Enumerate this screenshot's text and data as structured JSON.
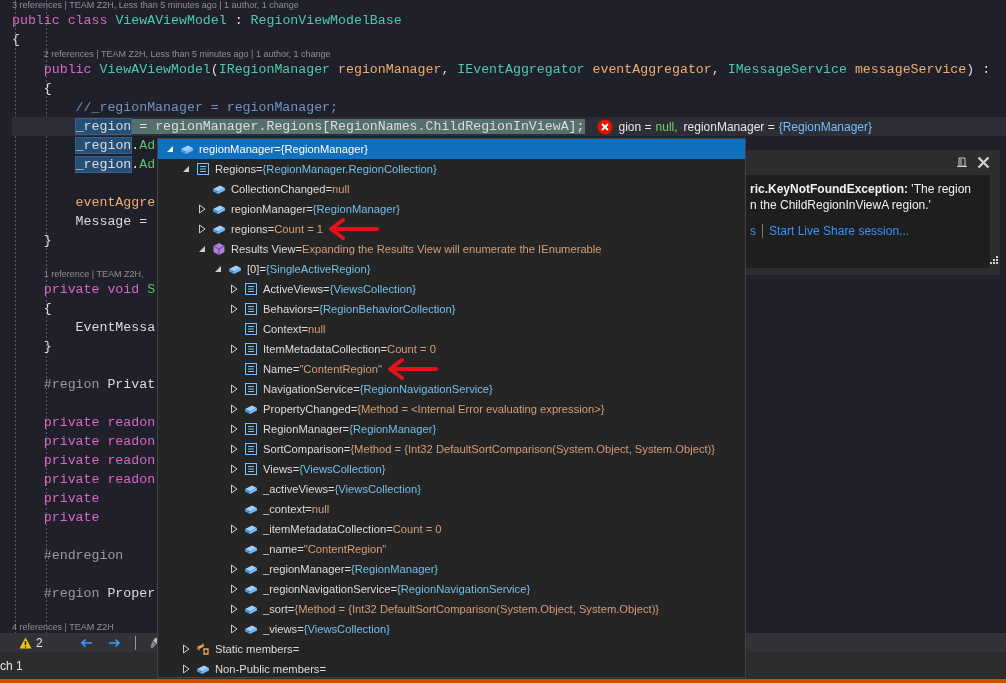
{
  "editor": {
    "lines": [
      {
        "kind": "lens",
        "text": "3 references | TEAM Z2H, Less than 5 minutes ago | 1 author, 1 change"
      },
      {
        "kind": "code",
        "tokens": [
          {
            "text": "public",
            "kind": "keyword"
          },
          {
            "text": " class",
            "kind": "keyword"
          },
          {
            "text": " ViewAViewModel",
            "kind": "type"
          },
          {
            "text": " :",
            "kind": "plain"
          },
          {
            "text": " RegionViewModelBase",
            "kind": "type"
          }
        ]
      },
      {
        "kind": "code",
        "tokens": [
          {
            "text": "{",
            "kind": "plain"
          }
        ]
      },
      {
        "kind": "lens",
        "text": "2 references | TEAM Z2H, Less than 5 minutes ago | 1 author, 1 change"
      },
      {
        "kind": "code",
        "tokens": [
          {
            "text": "    public",
            "kind": "keyword"
          },
          {
            "text": " ViewAViewModel",
            "kind": "type"
          },
          {
            "text": "(",
            "kind": "plain"
          },
          {
            "text": "IRegionManager",
            "kind": "type"
          },
          {
            "text": " regionManager",
            "kind": "param"
          },
          {
            "text": ",",
            "kind": "plain"
          },
          {
            "text": " IEventAggregator",
            "kind": "type"
          },
          {
            "text": " eventAggregator",
            "kind": "param"
          },
          {
            "text": ",",
            "kind": "plain"
          },
          {
            "text": " IMessageService",
            "kind": "type"
          },
          {
            "text": " messageService",
            "kind": "param"
          },
          {
            "text": ") :",
            "kind": "plain"
          }
        ]
      },
      {
        "kind": "code",
        "tokens": [
          {
            "text": "    {",
            "kind": "plain"
          }
        ]
      },
      {
        "kind": "code",
        "tokens": [
          {
            "text": "        //_regionManager = regionManager;",
            "kind": "comment"
          }
        ]
      },
      {
        "kind": "current",
        "tokens": [
          {
            "text": "        _region",
            "kind": "selected"
          },
          {
            "text": " = regionManager.Regions[RegionNames.ChildRegionInViewA];",
            "kind": "plain"
          }
        ],
        "datatip": [
          {
            "name": "gion =",
            "value": {
              "text": "null,",
              "kind": "literal"
            }
          },
          {
            "name": "regionManager =",
            "value": {
              "text": "{RegionManager}",
              "kind": "object"
            }
          }
        ]
      },
      {
        "kind": "code",
        "tokens": [
          {
            "text": "        _region",
            "kind": "selected"
          },
          {
            "text": ".",
            "kind": "plain"
          },
          {
            "text": "Ad",
            "kind": "method"
          }
        ]
      },
      {
        "kind": "code",
        "tokens": [
          {
            "text": "        _region",
            "kind": "selected"
          },
          {
            "text": ".",
            "kind": "plain"
          },
          {
            "text": "Ad",
            "kind": "method"
          }
        ]
      },
      {
        "kind": "blank"
      },
      {
        "kind": "code",
        "tokens": [
          {
            "text": "        eventAggre",
            "kind": "param"
          }
        ]
      },
      {
        "kind": "code",
        "tokens": [
          {
            "text": "        Message =",
            "kind": "plain"
          }
        ]
      },
      {
        "kind": "code",
        "tokens": [
          {
            "text": "    }",
            "kind": "plain"
          }
        ]
      },
      {
        "kind": "blank"
      },
      {
        "kind": "lens",
        "text": "1 reference | TEAM Z2H,"
      },
      {
        "kind": "code",
        "tokens": [
          {
            "text": "    private",
            "kind": "keyword"
          },
          {
            "text": " void",
            "kind": "keyword"
          },
          {
            "text": " S",
            "kind": "method"
          }
        ]
      },
      {
        "kind": "code",
        "tokens": [
          {
            "text": "    {",
            "kind": "plain"
          }
        ]
      },
      {
        "kind": "code",
        "tokens": [
          {
            "text": "        EventMessa",
            "kind": "plain"
          }
        ]
      },
      {
        "kind": "code",
        "tokens": [
          {
            "text": "    }",
            "kind": "plain"
          }
        ]
      },
      {
        "kind": "blank"
      },
      {
        "kind": "code",
        "tokens": [
          {
            "text": "    #region",
            "kind": "directive"
          },
          {
            "text": " Privat",
            "kind": "plain"
          }
        ]
      },
      {
        "kind": "blank"
      },
      {
        "kind": "code",
        "tokens": [
          {
            "text": "    private",
            "kind": "keyword"
          },
          {
            "text": " readon",
            "kind": "keyword"
          }
        ]
      },
      {
        "kind": "code",
        "tokens": [
          {
            "text": "    private",
            "kind": "keyword"
          },
          {
            "text": " readon",
            "kind": "keyword"
          }
        ]
      },
      {
        "kind": "code",
        "tokens": [
          {
            "text": "    private",
            "kind": "keyword"
          },
          {
            "text": " readon",
            "kind": "keyword"
          }
        ]
      },
      {
        "kind": "code",
        "tokens": [
          {
            "text": "    private",
            "kind": "keyword"
          },
          {
            "text": " readon",
            "kind": "keyword"
          }
        ]
      },
      {
        "kind": "code",
        "tokens": [
          {
            "text": "    private",
            "kind": "keyword"
          }
        ]
      },
      {
        "kind": "code",
        "tokens": [
          {
            "text": "    private",
            "kind": "keyword"
          }
        ]
      },
      {
        "kind": "blank"
      },
      {
        "kind": "code",
        "tokens": [
          {
            "text": "    #endregion",
            "kind": "directive"
          }
        ]
      },
      {
        "kind": "blank"
      },
      {
        "kind": "code",
        "tokens": [
          {
            "text": "    #region",
            "kind": "directive"
          },
          {
            "text": " Proper",
            "kind": "plain"
          }
        ]
      },
      {
        "kind": "blank"
      },
      {
        "kind": "lens",
        "text": "4 references | TEAM Z2H"
      }
    ]
  },
  "popup": {
    "items": [
      {
        "name": "regionManager=",
        "value": {
          "text": "{RegionManager}",
          "kind": "object"
        },
        "kind": "field",
        "expanded": true,
        "selected": true,
        "children": [
          {
            "name": "Regions=",
            "value": {
              "text": "{RegionManager.RegionCollection}",
              "kind": "object"
            },
            "kind": "property",
            "expanded": true,
            "selected": false,
            "children": [
              {
                "name": "CollectionChanged=",
                "value": {
                  "text": "null",
                  "kind": "literal"
                },
                "kind": "field",
                "selected": false
              },
              {
                "name": "regionManager=",
                "value": {
                  "text": "{RegionManager}",
                  "kind": "object"
                },
                "kind": "field",
                "expanded": false,
                "selected": false
              },
              {
                "name": "regions=",
                "value": {
                  "text": "Count = 1",
                  "kind": "literal"
                },
                "kind": "field",
                "expanded": false,
                "selected": false,
                "marked": true
              },
              {
                "name": "Results View=",
                "value": {
                  "text": "Expanding the Results View will enumerate the IEnumerable",
                  "kind": "literal"
                },
                "kind": "results",
                "expanded": true,
                "selected": false,
                "children": [
                  {
                    "name": "[0]=",
                    "value": {
                      "text": "{SingleActiveRegion}",
                      "kind": "object"
                    },
                    "kind": "field",
                    "expanded": true,
                    "selected": false,
                    "children": [
                      {
                        "name": "ActiveViews=",
                        "value": {
                          "text": "{ViewsCollection}",
                          "kind": "object"
                        },
                        "kind": "property",
                        "expanded": false,
                        "selected": false
                      },
                      {
                        "name": "Behaviors=",
                        "value": {
                          "text": "{RegionBehaviorCollection}",
                          "kind": "object"
                        },
                        "kind": "property",
                        "expanded": false,
                        "selected": false
                      },
                      {
                        "name": "Context=",
                        "value": {
                          "text": "null",
                          "kind": "literal"
                        },
                        "kind": "property",
                        "selected": false
                      },
                      {
                        "name": "ItemMetadataCollection=",
                        "value": {
                          "text": "Count = 0",
                          "kind": "literal"
                        },
                        "kind": "property",
                        "expanded": false,
                        "selected": false
                      },
                      {
                        "name": "Name=",
                        "value": {
                          "text": "\"ContentRegion\"",
                          "kind": "literal"
                        },
                        "kind": "property",
                        "selected": false,
                        "marked": true
                      },
                      {
                        "name": "NavigationService=",
                        "value": {
                          "text": "{RegionNavigationService}",
                          "kind": "object"
                        },
                        "kind": "property",
                        "expanded": false,
                        "selected": false
                      },
                      {
                        "name": "PropertyChanged=",
                        "value": {
                          "text": "{Method = <Internal Error evaluating expression>}",
                          "kind": "literal"
                        },
                        "kind": "field",
                        "expanded": false,
                        "selected": false
                      },
                      {
                        "name": "RegionManager=",
                        "value": {
                          "text": "{RegionManager}",
                          "kind": "object"
                        },
                        "kind": "property",
                        "expanded": false,
                        "selected": false
                      },
                      {
                        "name": "SortComparison=",
                        "value": {
                          "text": "{Method = {Int32 DefaultSortComparison(System.Object, System.Object)}",
                          "kind": "literal"
                        },
                        "kind": "property",
                        "expanded": false,
                        "selected": false
                      },
                      {
                        "name": "Views=",
                        "value": {
                          "text": "{ViewsCollection}",
                          "kind": "object"
                        },
                        "kind": "property",
                        "expanded": false,
                        "selected": false
                      },
                      {
                        "name": "_activeViews=",
                        "value": {
                          "text": "{ViewsCollection}",
                          "kind": "object"
                        },
                        "kind": "field",
                        "expanded": false,
                        "selected": false
                      },
                      {
                        "name": "_context=",
                        "value": {
                          "text": "null",
                          "kind": "literal"
                        },
                        "kind": "field",
                        "selected": false
                      },
                      {
                        "name": "_itemMetadataCollection=",
                        "value": {
                          "text": "Count = 0",
                          "kind": "literal"
                        },
                        "kind": "field",
                        "expanded": false,
                        "selected": false
                      },
                      {
                        "name": "_name=",
                        "value": {
                          "text": "\"ContentRegion\"",
                          "kind": "literal"
                        },
                        "kind": "field",
                        "selected": false
                      },
                      {
                        "name": "_regionManager=",
                        "value": {
                          "text": "{RegionManager}",
                          "kind": "object"
                        },
                        "kind": "field",
                        "expanded": false,
                        "selected": false
                      },
                      {
                        "name": "_regionNavigationService=",
                        "value": {
                          "text": "{RegionNavigationService}",
                          "kind": "object"
                        },
                        "kind": "field",
                        "expanded": false,
                        "selected": false
                      },
                      {
                        "name": "_sort=",
                        "value": {
                          "text": "{Method = {Int32 DefaultSortComparison(System.Object, System.Object)}",
                          "kind": "literal"
                        },
                        "kind": "field",
                        "expanded": false,
                        "selected": false
                      },
                      {
                        "name": "_views=",
                        "value": {
                          "text": "{ViewsCollection}",
                          "kind": "object"
                        },
                        "kind": "field",
                        "expanded": false,
                        "selected": false
                      }
                    ]
                  }
                ]
              }
            ]
          },
          {
            "name": "Static members=",
            "kind": "static",
            "expanded": false,
            "selected": false
          },
          {
            "name": "Non-Public members=",
            "kind": "field",
            "expanded": false,
            "selected": false
          }
        ]
      }
    ]
  },
  "exception": {
    "message_lines": [
      "**ric.KeyNotFoundException:** 'The region",
      "n the ChildRegionInViewA region.'"
    ],
    "links": [
      "s",
      "Start Live Share session..."
    ]
  },
  "status_bar": {
    "warnings": "2"
  },
  "bottom_tab": "ch 1"
}
